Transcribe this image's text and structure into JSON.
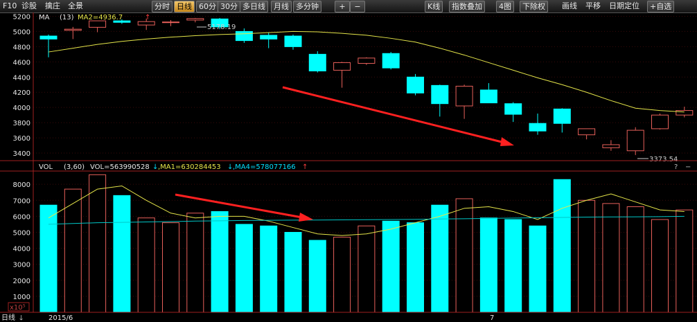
{
  "toolbar": {
    "left_items": [
      "F10",
      "诊股",
      "擒庄",
      "全景"
    ],
    "periods": [
      "分时",
      "日线",
      "60分",
      "30分",
      "多日线",
      "月线",
      "多分钟"
    ],
    "active_period": "日线",
    "zoom_in": "+",
    "zoom_out": "−",
    "right_items": [
      "K线",
      "指数叠加",
      "4图",
      "下除权",
      "画线",
      "平移",
      "日期定位",
      "+自选"
    ]
  },
  "price_panel": {
    "indicator_name": "MA",
    "param": "(13)",
    "ma_label": "MA2=4936.7",
    "ma_arrow": "↑",
    "high_label": "5178.19",
    "low_label": "3373.54"
  },
  "volume_panel": {
    "indicator_name": "VOL",
    "param": "(3,60)",
    "vol_label": "VOL=563990528",
    "vol_arrow": "↓",
    "ma1_label": ",MA1=630284453",
    "ma1_arrow": "↓",
    "ma4_label": ",MA4=578077166",
    "ma4_arrow": "↑",
    "unit_label": "x10⁵",
    "help": "?",
    "close": "−"
  },
  "bottom": {
    "period_label": "日线",
    "date_label": "2015/6",
    "month_label": "7"
  },
  "colors": {
    "up": "#e8605a",
    "down": "#00ffff",
    "ma_yellow": "#e6e64a",
    "ma_cyan": "#00c8c8",
    "arrow": "#ff2020",
    "axis": "#a02020",
    "toolbar_active": "#e8a534"
  },
  "chart_data": [
    {
      "type": "candlestick",
      "title": "",
      "ylim": [
        3300,
        5250
      ],
      "yticks": [
        3400,
        3600,
        3800,
        4000,
        4200,
        4400,
        4600,
        4800,
        5000,
        5200
      ],
      "candles": [
        {
          "o": 4940,
          "h": 4960,
          "l": 4660,
          "c": 4900
        },
        {
          "o": 5015,
          "h": 5060,
          "l": 4900,
          "c": 5030
        },
        {
          "o": 5055,
          "h": 5135,
          "l": 4990,
          "c": 5140
        },
        {
          "o": 5140,
          "h": 5160,
          "l": 5100,
          "c": 5120
        },
        {
          "o": 5085,
          "h": 5170,
          "l": 5020,
          "c": 5130
        },
        {
          "o": 5120,
          "h": 5150,
          "l": 5070,
          "c": 5125
        },
        {
          "o": 5150,
          "h": 5178,
          "l": 5120,
          "c": 5170
        },
        {
          "o": 5165,
          "h": 5178,
          "l": 5030,
          "c": 5060
        },
        {
          "o": 5000,
          "h": 5040,
          "l": 4850,
          "c": 4880
        },
        {
          "o": 4950,
          "h": 4990,
          "l": 4780,
          "c": 4900
        },
        {
          "o": 4940,
          "h": 4960,
          "l": 4760,
          "c": 4800
        },
        {
          "o": 4700,
          "h": 4740,
          "l": 4460,
          "c": 4480
        },
        {
          "o": 4490,
          "h": 4600,
          "l": 4260,
          "c": 4590
        },
        {
          "o": 4580,
          "h": 4660,
          "l": 4560,
          "c": 4650
        },
        {
          "o": 4710,
          "h": 4730,
          "l": 4500,
          "c": 4520
        },
        {
          "o": 4400,
          "h": 4440,
          "l": 4160,
          "c": 4190
        },
        {
          "o": 4290,
          "h": 4300,
          "l": 3880,
          "c": 4050
        },
        {
          "o": 4020,
          "h": 4300,
          "l": 3850,
          "c": 4280
        },
        {
          "o": 4230,
          "h": 4320,
          "l": 4060,
          "c": 4060
        },
        {
          "o": 4050,
          "h": 4070,
          "l": 3810,
          "c": 3910
        },
        {
          "o": 3790,
          "h": 3920,
          "l": 3640,
          "c": 3690
        },
        {
          "o": 3980,
          "h": 3990,
          "l": 3670,
          "c": 3790
        },
        {
          "o": 3640,
          "h": 3720,
          "l": 3580,
          "c": 3720
        },
        {
          "o": 3470,
          "h": 3570,
          "l": 3430,
          "c": 3510
        },
        {
          "o": 3430,
          "h": 3740,
          "l": 3373.54,
          "c": 3700
        },
        {
          "o": 3720,
          "h": 3920,
          "l": 3710,
          "c": 3900
        },
        {
          "o": 3900,
          "h": 4010,
          "l": 3870,
          "c": 3960
        }
      ],
      "ma13": [
        4730,
        4780,
        4830,
        4870,
        4900,
        4925,
        4945,
        4960,
        4970,
        4985,
        5000,
        4995,
        4975,
        4950,
        4910,
        4860,
        4780,
        4690,
        4590,
        4490,
        4390,
        4300,
        4200,
        4090,
        3990,
        3960,
        3940
      ]
    },
    {
      "type": "bar",
      "title": "",
      "ylim": [
        0,
        8700
      ],
      "yticks": [
        1000,
        2000,
        3000,
        4000,
        5000,
        6000,
        7000,
        8000
      ],
      "values": [
        6700,
        7700,
        8600,
        7300,
        5900,
        5600,
        6200,
        6300,
        5500,
        5400,
        5000,
        4500,
        4700,
        5400,
        5700,
        5600,
        6700,
        7100,
        5900,
        5800,
        5400,
        8300,
        7000,
        6800,
        6600,
        5800,
        6400
      ],
      "ma1": [
        5900,
        6800,
        7700,
        7900,
        7000,
        6200,
        5900,
        6000,
        6000,
        5700,
        5300,
        4900,
        4800,
        4900,
        5200,
        5600,
        6000,
        6500,
        6600,
        6300,
        5800,
        6500,
        7000,
        7400,
        6900,
        6400,
        6300
      ],
      "ma4": [
        5500,
        5550,
        5600,
        5620,
        5650,
        5670,
        5700,
        5720,
        5740,
        5750,
        5760,
        5770,
        5780,
        5790,
        5800,
        5810,
        5830,
        5850,
        5870,
        5890,
        5910,
        5930,
        5950,
        5960,
        5970,
        5980,
        6000
      ]
    }
  ]
}
